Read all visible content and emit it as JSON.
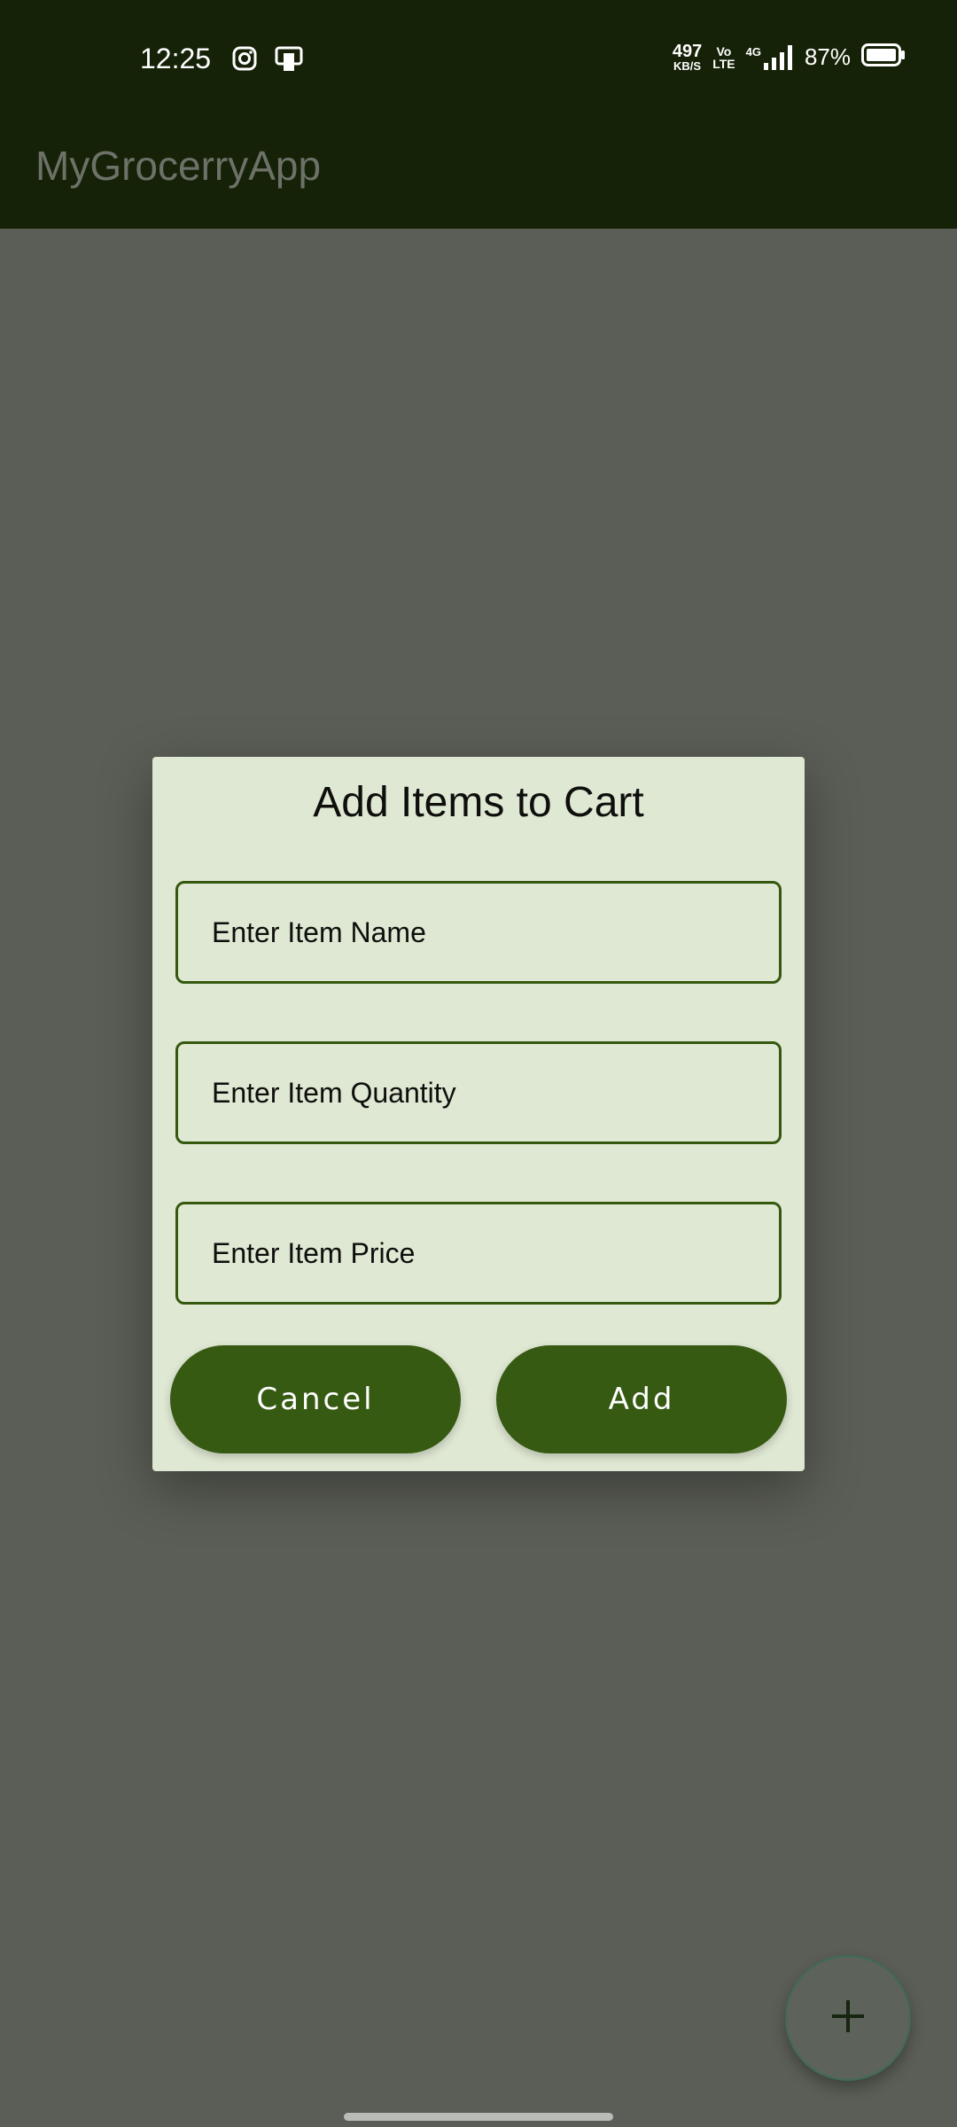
{
  "status_bar": {
    "time": "12:25",
    "net_speed_value": "497",
    "net_speed_unit": "KB/S",
    "volte_top": "Vo",
    "volte_bottom": "LTE",
    "network": "4G",
    "battery_percent": "87%",
    "left_icons": [
      "instagram-icon",
      "notification-app-icon"
    ],
    "right_icons": [
      "volte-icon",
      "signal-4g-icon",
      "battery-icon"
    ]
  },
  "app_bar": {
    "title": "MyGrocerryApp"
  },
  "dialog": {
    "title": "Add Items to Cart",
    "fields": {
      "name_placeholder": "Enter Item Name",
      "quantity_placeholder": "Enter Item Quantity",
      "price_placeholder": "Enter Item Price"
    },
    "cancel_label": "Cancel",
    "add_label": "Add"
  },
  "fab": {
    "icon": "plus-icon"
  },
  "colors": {
    "status_bar_bg": "#152207",
    "scrim": "#5b5e56",
    "dialog_bg": "#dfe8d3",
    "accent_green": "#365a12",
    "field_border": "#35580f"
  }
}
